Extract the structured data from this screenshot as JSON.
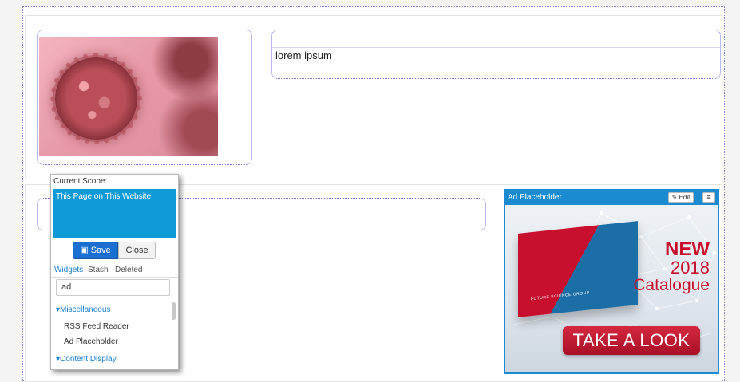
{
  "top_text": {
    "lorem": "lorem ipsum"
  },
  "ad": {
    "title": "Ad Placeholder",
    "edit_label": "Edit",
    "menu_icon": "≡",
    "edit_icon": "✎",
    "banner": {
      "brand": "FUTURE SCIENCE GROUP",
      "line1": "NEW",
      "line2": "2018",
      "line3": "Catalogue",
      "cta": "TAKE A LOOK"
    }
  },
  "panel": {
    "scope_label": "Current Scope:",
    "scope_value": "This Page on This Website",
    "save_label": "Save",
    "close_label": "Close",
    "tabs": [
      "Widgets",
      "Stash",
      "Deleted"
    ],
    "search_value": "ad",
    "categories": [
      {
        "label": "Miscellaneous",
        "items": [
          "RSS Feed Reader",
          "Ad Placeholder"
        ]
      },
      {
        "label": "Content Display",
        "items": []
      }
    ]
  },
  "colors": {
    "accent": "#1a8bd0",
    "scope_bg": "#109ad8",
    "save_bg": "#1a6fd0",
    "brand_red": "#c8102e"
  }
}
